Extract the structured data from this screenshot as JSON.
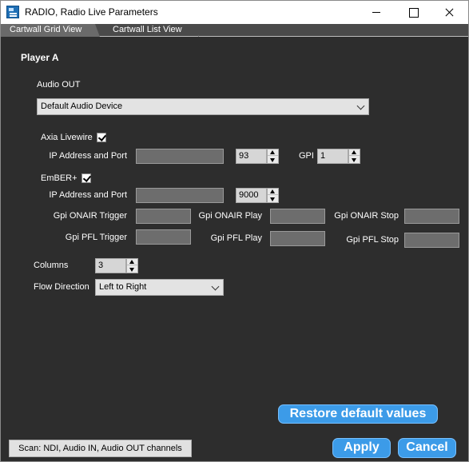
{
  "window": {
    "title": "RADIO, Radio Live Parameters"
  },
  "tabs": [
    {
      "label": "Cartwall Grid View",
      "active": true
    },
    {
      "label": "Cartwall List View",
      "active": false
    }
  ],
  "player": {
    "title": "Player A",
    "audio_out": {
      "label": "Audio OUT",
      "selected": "Default Audio Device"
    },
    "axia": {
      "label": "Axia Livewire",
      "checked": true,
      "ip_label": "IP Address and Port",
      "ip_value": "",
      "port_value": "93",
      "gpi_label": "GPI",
      "gpi_value": "1"
    },
    "ember": {
      "label": "EmBER+",
      "checked": true,
      "ip_label": "IP Address and Port",
      "ip_value": "",
      "port_value": "9000",
      "gpi_onair_trigger_label": "Gpi ONAIR Trigger",
      "gpi_onair_play_label": "Gpi ONAIR Play",
      "gpi_onair_stop_label": "Gpi ONAIR Stop",
      "gpi_pfl_trigger_label": "Gpi PFL Trigger",
      "gpi_pfl_play_label": "Gpi PFL Play",
      "gpi_pfl_stop_label": "Gpi PFL Stop"
    },
    "columns": {
      "label": "Columns",
      "value": "3"
    },
    "flow_direction": {
      "label": "Flow Direction",
      "selected": "Left to Right"
    }
  },
  "buttons": {
    "restore": "Restore default values",
    "scan": "Scan: NDI, Audio IN, Audio OUT channels",
    "apply": "Apply",
    "cancel": "Cancel"
  },
  "colors": {
    "background": "#2d2d2d",
    "accent": "#3c9be8",
    "field_dark": "#6d6d6d"
  }
}
